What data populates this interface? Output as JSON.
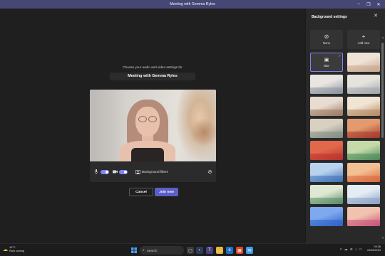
{
  "window": {
    "title": "Meeting with Gemma Ryles",
    "min_icon": "minimize-icon",
    "max_icon": "maximize-icon",
    "close_icon": "close-icon"
  },
  "prejoin": {
    "prompt": "Choose your audio and video settings for",
    "meeting_title": "Meeting with Gemma Ryles",
    "bg_filters_label": "Background filters",
    "cancel_label": "Cancel",
    "join_label": "Join now",
    "mic_on": true,
    "camera_on": true,
    "accent": "#5b5fc7"
  },
  "panel": {
    "title": "Background settings",
    "none_label": "None",
    "add_label": "Add new",
    "blur_label": "Blur",
    "selected": "Blur",
    "backgrounds": [
      {
        "c1": "#c8a78f",
        "c2": "#efe3d6"
      },
      {
        "c1": "#8b93a0",
        "c2": "#e9e6e1"
      },
      {
        "c1": "#a0a7ad",
        "c2": "#e6e3dd"
      },
      {
        "c1": "#9c7a62",
        "c2": "#e7dccf"
      },
      {
        "c1": "#b78a62",
        "c2": "#f0e4d3"
      },
      {
        "c1": "#7f8e83",
        "c2": "#d9d0c2"
      },
      {
        "c1": "#a53a2b",
        "c2": "#e39a6f"
      },
      {
        "c1": "#b8342e",
        "c2": "#e2684b"
      },
      {
        "c1": "#4d8b5a",
        "c2": "#c6d9a8"
      },
      {
        "c1": "#3f73b8",
        "c2": "#b9d3ef"
      },
      {
        "c1": "#d96a3f",
        "c2": "#f3c092"
      },
      {
        "c1": "#5a8e6a",
        "c2": "#dfe8d3"
      },
      {
        "c1": "#8aa3c4",
        "c2": "#e4ecf4"
      },
      {
        "c1": "#2d63c8",
        "c2": "#7ea9ef"
      },
      {
        "c1": "#c7557a",
        "c2": "#f2c2b0"
      },
      {
        "c1": "#d8543a",
        "c2": "#f5b77c"
      },
      {
        "c1": "#7d6fd6",
        "c2": "#c6b9f2"
      },
      {
        "c1": "#4e8fd3",
        "c2": "#a8d1f2"
      }
    ]
  },
  "taskbar": {
    "weather_temp": "19°C",
    "weather_desc": "Rain coming",
    "search_placeholder": "Search",
    "time": "09:36",
    "date": "24/08/2023"
  }
}
